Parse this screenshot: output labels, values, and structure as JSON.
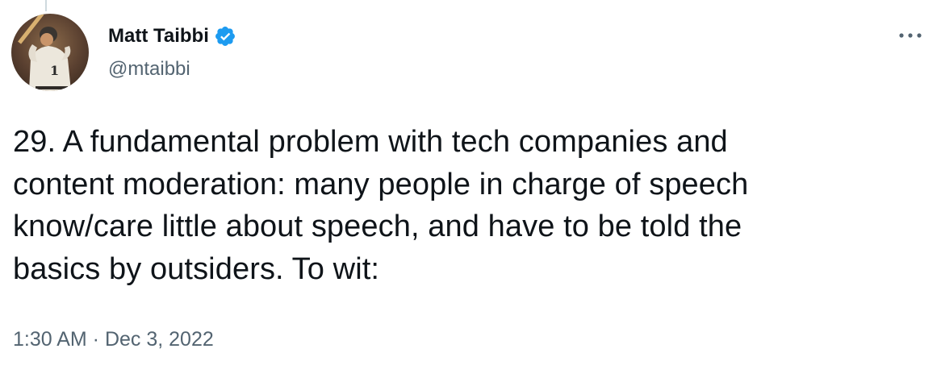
{
  "author": {
    "display_name": "Matt Taibbi",
    "handle": "@mtaibbi",
    "verified": true,
    "avatar_icon": "avatar-baseball-player"
  },
  "menu": {
    "icon": "more-horizontal-icon"
  },
  "tweet": {
    "text_lines": [
      "29. A fundamental problem with tech companies and",
      "content moderation: many people in charge of speech",
      "know/care little about speech, and have to be told the",
      "basics by outsiders. To wit:"
    ],
    "timestamp": "1:30 AM · Dec 3, 2022"
  },
  "colors": {
    "text_primary": "#0f1419",
    "text_secondary": "#536471",
    "verified_blue": "#1d9bf0",
    "divider": "#cfd9de"
  }
}
